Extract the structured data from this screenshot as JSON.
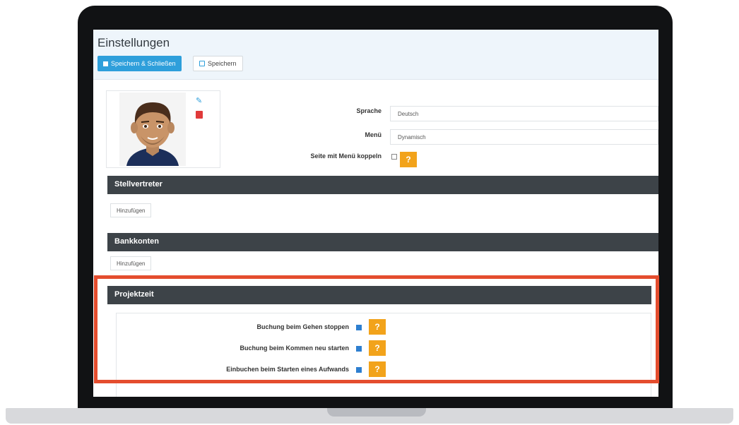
{
  "page": {
    "title": "Einstellungen"
  },
  "toolbar": {
    "save_close_label": "Speichern & Schließen",
    "save_label": "Speichern"
  },
  "profile": {
    "language_label": "Sprache",
    "language_value": "Deutsch",
    "menu_label": "Menü",
    "menu_value": "Dynamisch",
    "couple_label": "Seite mit Menü koppeln",
    "couple_checked": false
  },
  "sections": {
    "stellvertreter": {
      "title": "Stellvertreter",
      "add_label": "Hinzufügen"
    },
    "bankkonten": {
      "title": "Bankkonten",
      "add_label": "Hinzufügen"
    },
    "projektzeit": {
      "title": "Projektzeit",
      "options": [
        {
          "label": "Buchung beim Gehen stoppen",
          "checked": true
        },
        {
          "label": "Buchung beim Kommen neu starten",
          "checked": true
        },
        {
          "label": "Einbuchen beim Starten eines Aufwands",
          "checked": true
        }
      ]
    }
  },
  "help_label": "?",
  "icons": {
    "edit": "pencil-icon",
    "delete": "trash-icon",
    "save": "disk-icon",
    "save_close": "square-icon"
  },
  "colors": {
    "primary": "#2e9fdb",
    "section_bar": "#3d4348",
    "help": "#f2a31b",
    "highlight": "#e44d2e",
    "delete": "#e03a3a"
  }
}
